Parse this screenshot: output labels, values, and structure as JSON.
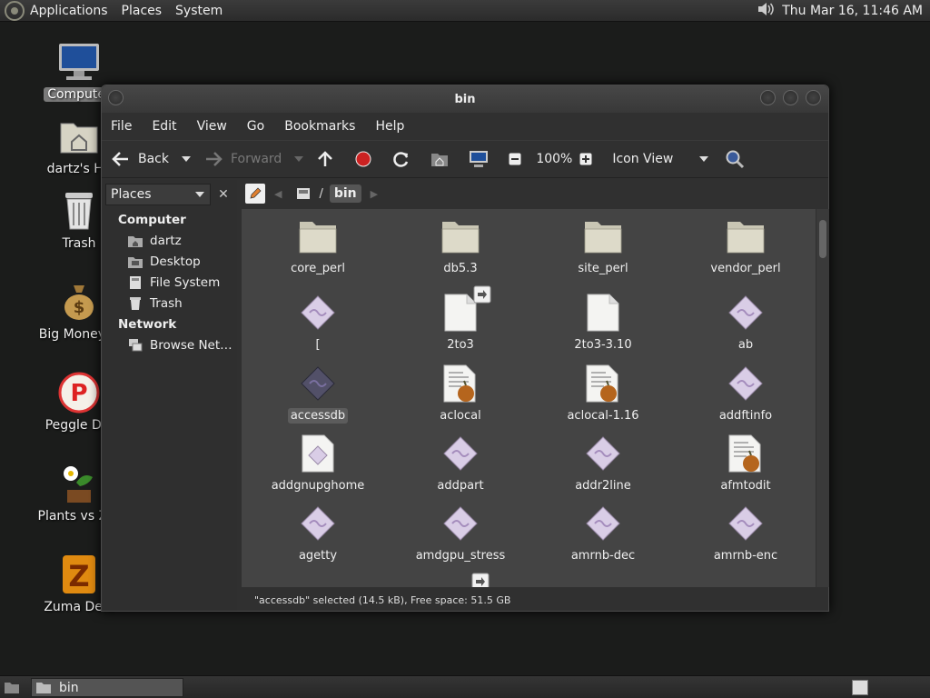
{
  "top_panel": {
    "menus": [
      "Applications",
      "Places",
      "System"
    ],
    "clock": "Thu Mar 16, 11:46 AM"
  },
  "desktop_icons": [
    {
      "label": "Computer",
      "icon": "computer-icon",
      "selected": true
    },
    {
      "label": "dartz's Ho",
      "icon": "home-folder-icon"
    },
    {
      "label": "Trash",
      "icon": "trash-icon"
    },
    {
      "label": "Big Money D",
      "icon": "money-bag-icon"
    },
    {
      "label": "Peggle Del",
      "icon": "peggle-icon"
    },
    {
      "label": "Plants vs Zor",
      "icon": "plants-icon"
    },
    {
      "label": "Zuma Delu",
      "icon": "zuma-icon"
    }
  ],
  "window": {
    "title": "bin",
    "menu": [
      "File",
      "Edit",
      "View",
      "Go",
      "Bookmarks",
      "Help"
    ],
    "toolbar": {
      "back": "Back",
      "forward": "Forward",
      "zoom": "100%",
      "view_mode": "Icon View"
    },
    "side_pane": {
      "selector": "Places",
      "sections": [
        {
          "title": "Computer",
          "items": [
            {
              "label": "dartz",
              "icon": "home-icon"
            },
            {
              "label": "Desktop",
              "icon": "desktop-icon"
            },
            {
              "label": "File System",
              "icon": "drive-icon"
            },
            {
              "label": "Trash",
              "icon": "trash-icon"
            }
          ]
        },
        {
          "title": "Network",
          "items": [
            {
              "label": "Browse Net…",
              "icon": "network-icon"
            }
          ]
        }
      ]
    },
    "path": "bin",
    "files": [
      {
        "name": "core_perl",
        "type": "folder"
      },
      {
        "name": "db5.3",
        "type": "folder"
      },
      {
        "name": "site_perl",
        "type": "folder"
      },
      {
        "name": "vendor_perl",
        "type": "folder"
      },
      {
        "name": "[",
        "type": "exec"
      },
      {
        "name": "2to3",
        "type": "doc",
        "link": true
      },
      {
        "name": "2to3-3.10",
        "type": "doc"
      },
      {
        "name": "ab",
        "type": "exec"
      },
      {
        "name": "accessdb",
        "type": "exec",
        "selected": true
      },
      {
        "name": "aclocal",
        "type": "script"
      },
      {
        "name": "aclocal-1.16",
        "type": "script"
      },
      {
        "name": "addftinfo",
        "type": "exec"
      },
      {
        "name": "addgnupghome",
        "type": "execdoc"
      },
      {
        "name": "addpart",
        "type": "exec"
      },
      {
        "name": "addr2line",
        "type": "exec"
      },
      {
        "name": "afmtodit",
        "type": "script"
      },
      {
        "name": "agetty",
        "type": "exec"
      },
      {
        "name": "amdgpu_stress",
        "type": "exec"
      },
      {
        "name": "amrnb-dec",
        "type": "exec"
      },
      {
        "name": "amrnb-enc",
        "type": "exec"
      }
    ],
    "status": "\"accessdb\" selected (14.5 kB), Free space: 51.5 GB"
  },
  "taskbar": {
    "items": [
      {
        "label": "bin",
        "icon": "folder-icon"
      }
    ]
  }
}
